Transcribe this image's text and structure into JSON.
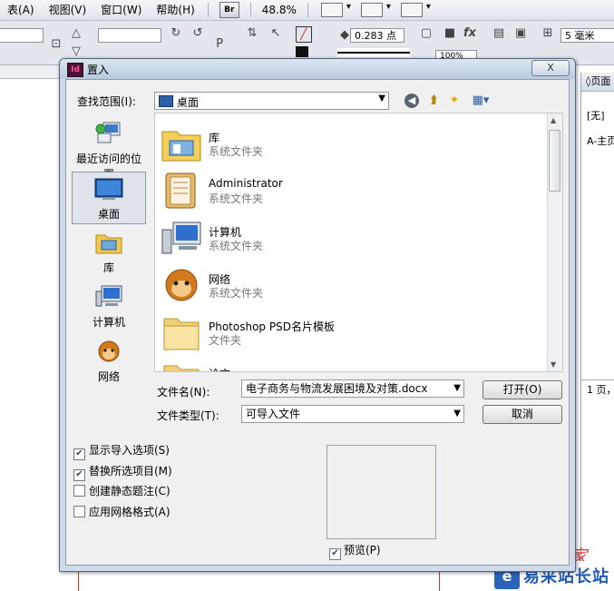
{
  "menu": {
    "items": [
      "表(A)",
      "视图(V)",
      "窗口(W)",
      "帮助(H)"
    ],
    "bridge_badge": "Br",
    "zoom": "48.8%"
  },
  "controls": {
    "stroke_weight": "0.283 点",
    "percent": "100%",
    "gap": "5 毫米",
    "fx": "fx"
  },
  "right_panel": {
    "header": "页面",
    "none_item": "[无]",
    "master_item": "A-主页",
    "footer": "1 页，"
  },
  "dialog": {
    "title": "置入",
    "title_icon": "Id",
    "close_label": "X",
    "look_in_label": "查找范围(I):",
    "look_in_value": "桌面",
    "places": [
      {
        "label": "最近访问的位置",
        "icon": "recent-places-icon"
      },
      {
        "label": "桌面",
        "icon": "desktop-icon",
        "selected": true
      },
      {
        "label": "库",
        "icon": "library-icon"
      },
      {
        "label": "计算机",
        "icon": "computer-icon"
      },
      {
        "label": "网络",
        "icon": "network-icon"
      }
    ],
    "files": [
      {
        "name": "库",
        "sub": "系统文件夹",
        "icon": "library-folder-icon"
      },
      {
        "name": "Administrator",
        "sub": "系统文件夹",
        "icon": "user-folder-icon"
      },
      {
        "name": "计算机",
        "sub": "系统文件夹",
        "icon": "computer-icon"
      },
      {
        "name": "网络",
        "sub": "系统文件夹",
        "icon": "network-icon"
      },
      {
        "name": "Photoshop PSD名片模板",
        "sub": "文件夹",
        "icon": "folder-icon"
      },
      {
        "name": "论文",
        "sub": "",
        "icon": "folder-icon"
      }
    ],
    "file_name_label": "文件名(N):",
    "file_name_value": "电子商务与物流发展困境及对策.docx",
    "file_type_label": "文件类型(T):",
    "file_type_value": "可导入文件",
    "open_button": "打开(O)",
    "cancel_button": "取消",
    "options": [
      {
        "label": "显示导入选项(S)",
        "checked": true
      },
      {
        "label": "替换所选项目(M)",
        "checked": true
      },
      {
        "label": "创建静态题注(C)",
        "checked": false
      },
      {
        "label": "应用网格格式(A)",
        "checked": false
      }
    ],
    "preview_label": "预览(P)",
    "preview_checked": true
  },
  "watermark": {
    "site": "易采站长站",
    "red_text": "脚本之家"
  },
  "colors": {
    "accent_blue": "#2c5fa8",
    "dialog_frame": "#cfdbe8",
    "indesign_icon": "#4b1232"
  }
}
